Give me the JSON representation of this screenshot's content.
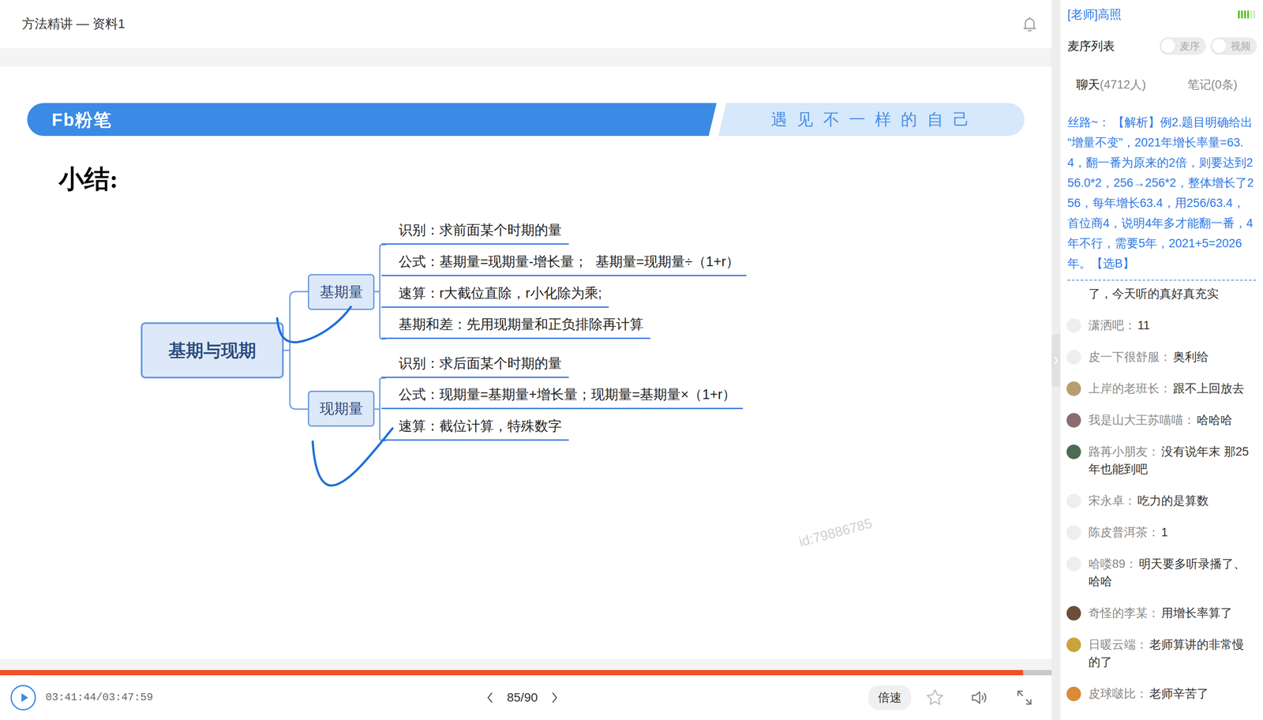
{
  "header": {
    "title": "方法精讲 — 资料1"
  },
  "slide": {
    "logo": "Fb粉笔",
    "slogan": "遇 见 不 一 样 的 自 己",
    "heading": "小结:",
    "mindmap": {
      "root": "基期与现期",
      "branches": [
        {
          "label": "基期量",
          "leaves": [
            "识别：求前面某个时期的量",
            "公式：基期量=现期量-增长量；  基期量=现期量÷（1+r）",
            "速算：r大截位直除，r小化除为乘;",
            "基期和差：先用现期量和正负排除再计算"
          ]
        },
        {
          "label": "现期量",
          "leaves": [
            "识别：求后面某个时期的量",
            "公式：现期量=基期量+增长量；现期量=基期量×（1+r）",
            "速算：截位计算，特殊数字"
          ]
        }
      ]
    },
    "watermark": "id:79886785"
  },
  "player": {
    "playing": false,
    "time": "03:41:44/03:47:59",
    "progress": {
      "level": 0.973
    },
    "page": "85/90",
    "speed": "倍速",
    "favorite": false
  },
  "sidebar": {
    "teacher": "[老师]高照",
    "signal": {
      "level": 0.67
    },
    "mic_list": {
      "title": "麦序列表",
      "toggles": [
        {
          "label": "麦序",
          "on": false
        },
        {
          "label": "视频",
          "on": false
        }
      ]
    },
    "tabs": [
      {
        "label": "聊天",
        "count": "(4712人)",
        "selected": true
      },
      {
        "label": "笔记",
        "count": "(0条)",
        "selected": false
      }
    ],
    "pinned": {
      "user": "丝路~：",
      "text": "【解析】例2.题目明确给出“增量不变”，2021年增长率量=63.4，翻一番为原来的2倍，则要达到256.0*2，256→256*2，整体增长了256，每年增长63.4，用256/63.4，首位商4，说明4年多才能翻一番，4年不行，需要5年，2021+5=2026年。【选B】"
    },
    "separator": "：",
    "messages": [
      {
        "kind": "continuation",
        "text": "了，今天听的真好真充实"
      },
      {
        "kind": "message",
        "user": "潇洒吧",
        "text": "11",
        "avatar": {
          "photo": false,
          "color": "#eeeeee"
        }
      },
      {
        "kind": "message",
        "user": "皮一下很舒服",
        "text": "奥利给",
        "avatar": {
          "photo": false,
          "color": "#eeeeee"
        }
      },
      {
        "kind": "message",
        "user": "上岸的老班长",
        "text": "跟不上回放去",
        "avatar": {
          "photo": true,
          "color": "#b89f72"
        }
      },
      {
        "kind": "message",
        "user": "我是山大王苏喵喵",
        "text": "哈哈哈",
        "avatar": {
          "photo": true,
          "color": "#8a6d70"
        }
      },
      {
        "kind": "message",
        "user": "路苒小朋友",
        "text": "没有说年末 那25年也能到吧",
        "avatar": {
          "photo": true,
          "color": "#4d6b52"
        }
      },
      {
        "kind": "message",
        "user": "宋永卓",
        "text": "吃力的是算数",
        "avatar": {
          "photo": false,
          "color": "#eeeeee"
        }
      },
      {
        "kind": "message",
        "user": "陈皮普洱茶",
        "text": "1",
        "avatar": {
          "photo": false,
          "color": "#eeeeee"
        }
      },
      {
        "kind": "message",
        "user": "哈喽89",
        "text": "明天要多听录播了、哈哈",
        "avatar": {
          "photo": false,
          "color": "#eeeeee"
        }
      },
      {
        "kind": "message",
        "user": "奇怪的李某",
        "text": "用增长率算了",
        "avatar": {
          "photo": true,
          "color": "#6b4e3a"
        }
      },
      {
        "kind": "message",
        "user": "日暖云端",
        "text": "老师算讲的非常慢的了",
        "avatar": {
          "photo": true,
          "color": "#c9a43a"
        }
      },
      {
        "kind": "message",
        "user": "皮球啵比",
        "text": "老师辛苦了",
        "avatar": {
          "photo": true,
          "color": "#d98b3a"
        }
      }
    ]
  }
}
